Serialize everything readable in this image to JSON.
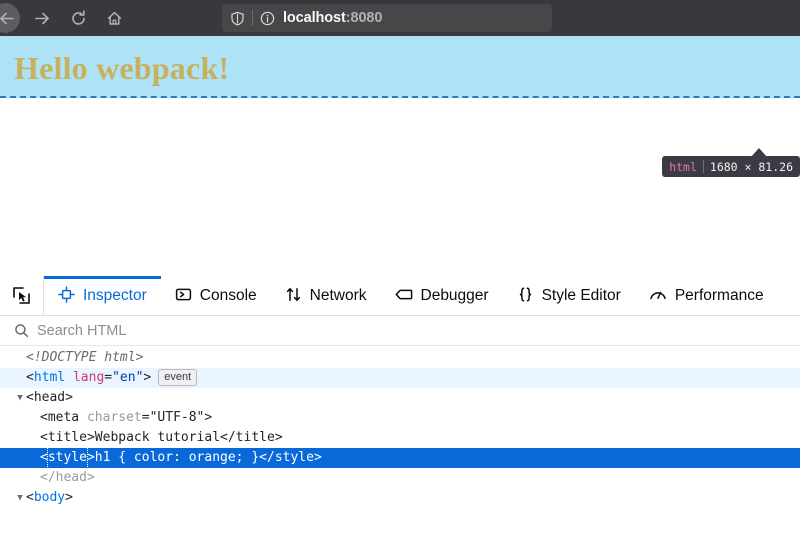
{
  "browser": {
    "nav": {
      "back_label": "Back",
      "forward_label": "Forward",
      "reload_label": "Reload",
      "home_label": "Home"
    },
    "urlbar": {
      "shield_icon": "shield-icon",
      "info_icon": "info-circle-icon",
      "host": "localhost",
      "port": ":8080"
    }
  },
  "page": {
    "heading": "Hello webpack!",
    "heading_color": "#c6b15f",
    "highlight_color": "#aee3f7",
    "badge": {
      "tag": "html",
      "dimensions": "1680 × 81.26"
    }
  },
  "devtools": {
    "picker_icon": "element-picker-icon",
    "tabs": [
      {
        "label": "Inspector",
        "icon": "inspector-icon",
        "active": true
      },
      {
        "label": "Console",
        "icon": "console-icon",
        "active": false
      },
      {
        "label": "Network",
        "icon": "network-icon",
        "active": false
      },
      {
        "label": "Debugger",
        "icon": "debugger-icon",
        "active": false
      },
      {
        "label": "Style Editor",
        "icon": "braces-icon",
        "active": false
      },
      {
        "label": "Performance",
        "icon": "performance-icon",
        "active": false
      }
    ],
    "search": {
      "icon": "search-icon",
      "placeholder": "Search HTML",
      "value": ""
    },
    "markup": {
      "rows": [
        {
          "text": "<!DOCTYPE html>"
        },
        {
          "tag": "html",
          "attr": "lang",
          "value": "\"en\"",
          "badge": "event"
        },
        {
          "tag": "head"
        },
        {
          "tag": "meta",
          "attr": "charset",
          "value": "\"UTF-8\""
        },
        {
          "tag": "title",
          "text": "Webpack tutorial",
          "close": "</title>"
        },
        {
          "tag": "style",
          "text": "h1 { color: orange; }",
          "close": "</style>",
          "selected": true
        },
        {
          "close": "</head>"
        },
        {
          "tag": "body"
        }
      ]
    }
  }
}
